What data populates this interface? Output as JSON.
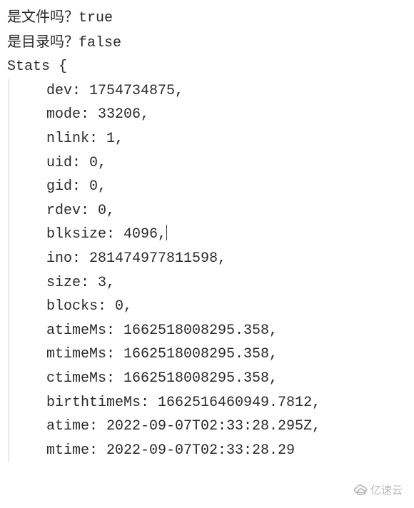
{
  "header": {
    "line1_label": "是文件吗？",
    "line1_value": "true",
    "line2_label": "是目录吗？",
    "line2_value": "false"
  },
  "object_open": "Stats {",
  "stats": {
    "dev": "  dev: 1754734875,",
    "mode": "  mode: 33206,",
    "nlink": "  nlink: 1,",
    "uid": "  uid: 0,",
    "gid": "  gid: 0,",
    "rdev": "  rdev: 0,",
    "blksize": "  blksize: 4096,",
    "ino": "  ino: 281474977811598,",
    "size": "  size: 3,",
    "blocks": "  blocks: 0,",
    "atimeMs": "  atimeMs: 1662518008295.358,",
    "mtimeMs": "  mtimeMs: 1662518008295.358,",
    "ctimeMs": "  ctimeMs: 1662518008295.358,",
    "birthtimeMs": "  birthtimeMs: 1662516460949.7812,",
    "atime": "  atime: 2022-09-07T02:33:28.295Z,",
    "mtime": "  mtime: 2022-09-07T02:33:28.29"
  },
  "watermark": {
    "text": "亿速云"
  }
}
